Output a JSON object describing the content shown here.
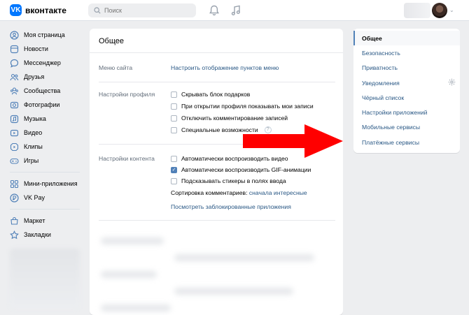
{
  "header": {
    "logo_text": "вконтакте",
    "logo_glyph": "VK",
    "search_placeholder": "Поиск"
  },
  "leftnav": [
    {
      "label": "Моя страница",
      "icon": "profile-icon"
    },
    {
      "label": "Новости",
      "icon": "news-icon"
    },
    {
      "label": "Мессенджер",
      "icon": "message-icon"
    },
    {
      "label": "Друзья",
      "icon": "friends-icon"
    },
    {
      "label": "Сообщества",
      "icon": "communities-icon"
    },
    {
      "label": "Фотографии",
      "icon": "photo-icon"
    },
    {
      "label": "Музыка",
      "icon": "music-icon"
    },
    {
      "label": "Видео",
      "icon": "video-icon"
    },
    {
      "label": "Клипы",
      "icon": "clips-icon"
    },
    {
      "label": "Игры",
      "icon": "games-icon"
    },
    {
      "label": "Мини-приложения",
      "icon": "mini-apps-icon"
    },
    {
      "label": "VK Pay",
      "icon": "vkpay-icon"
    },
    {
      "label": "Маркет",
      "icon": "market-icon"
    },
    {
      "label": "Закладки",
      "icon": "bookmarks-icon"
    }
  ],
  "main": {
    "title": "Общее",
    "site_menu": {
      "label": "Меню сайта",
      "link": "Настроить отображение пунктов меню"
    },
    "profile": {
      "label": "Настройки профиля",
      "options": [
        {
          "label": "Скрывать блок подарков",
          "checked": false
        },
        {
          "label": "При открытии профиля показывать мои записи",
          "checked": false
        },
        {
          "label": "Отключить комментирование записей",
          "checked": false
        },
        {
          "label": "Специальные возможности",
          "checked": false
        }
      ],
      "help_glyph": "?"
    },
    "content": {
      "label": "Настройки контента",
      "options": [
        {
          "label": "Автоматически воспроизводить видео",
          "checked": false
        },
        {
          "label": "Автоматически воспроизводить GIF-анимации",
          "checked": true
        },
        {
          "label": "Подсказывать стикеры в полях ввода",
          "checked": false
        }
      ],
      "sort_label": "Сортировка комментариев:",
      "sort_value": "сначала интересные",
      "blocked_link": "Посмотреть заблокированные приложения"
    }
  },
  "rightnav": [
    {
      "label": "Общее",
      "active": true
    },
    {
      "label": "Безопасность",
      "active": false
    },
    {
      "label": "Приватность",
      "active": false
    },
    {
      "label": "Уведомления",
      "active": false
    },
    {
      "label": "Чёрный список",
      "active": false
    },
    {
      "label": "Настройки приложений",
      "active": false
    },
    {
      "label": "Мобильные сервисы",
      "active": false
    },
    {
      "label": "Платёжные сервисы",
      "active": false
    }
  ],
  "colors": {
    "accent": "#5181b8",
    "link": "#2a5885",
    "arrow": "#ff0000",
    "background": "#edeef0"
  }
}
